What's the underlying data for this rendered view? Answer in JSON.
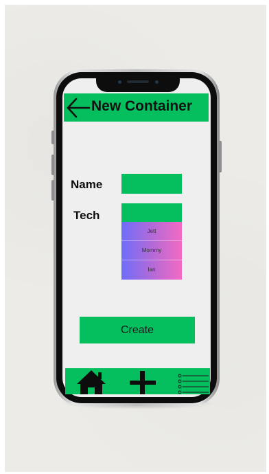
{
  "header": {
    "title": "New Container"
  },
  "form": {
    "name_label": "Name",
    "tech_label": "Tech",
    "name_value": "",
    "tech_value": ""
  },
  "dropdown": {
    "options": [
      "Jett",
      "Mommy",
      "Ian"
    ]
  },
  "actions": {
    "create_label": "Create"
  },
  "colors": {
    "accent_green": "#05be5e",
    "dropdown_gradient_start": "#6e6dfb",
    "dropdown_gradient_end": "#f36ac4",
    "screen_background": "#efefef"
  },
  "icons": {
    "header": "back-arrow-icon",
    "bottom_nav": [
      "home-icon",
      "plus-icon",
      "list-icon"
    ]
  }
}
